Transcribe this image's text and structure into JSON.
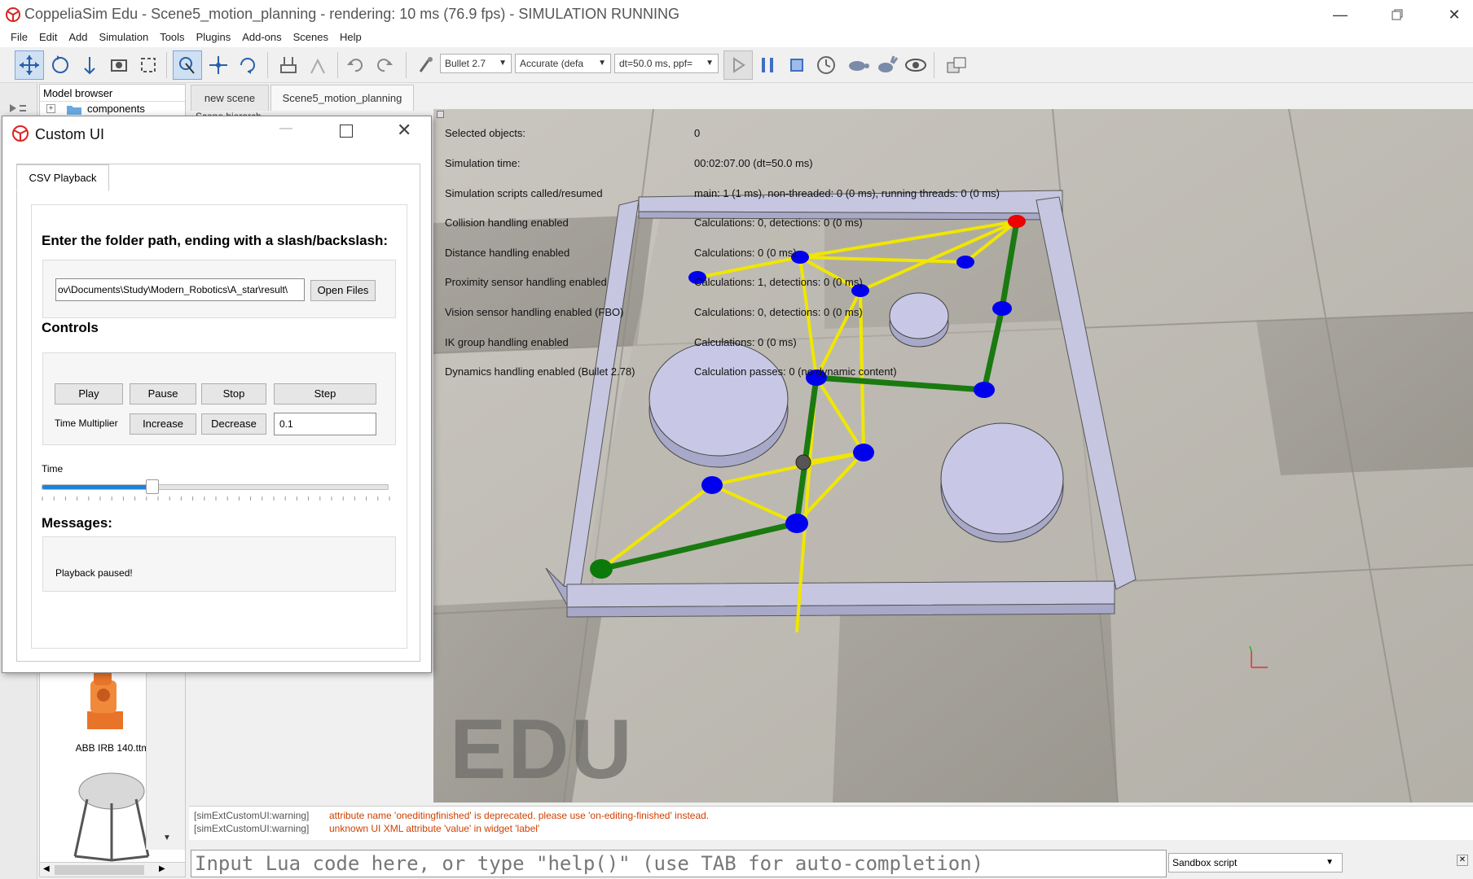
{
  "window": {
    "title": "CoppeliaSim Edu - Scene5_motion_planning - rendering: 10 ms (76.9 fps) - SIMULATION RUNNING"
  },
  "menu": [
    "File",
    "Edit",
    "Add",
    "Simulation",
    "Tools",
    "Plugins",
    "Add-ons",
    "Scenes",
    "Help"
  ],
  "toolbar": {
    "engine": "Bullet 2.7",
    "accuracy": "Accurate (defa",
    "timestep": "dt=50.0 ms, ppf="
  },
  "model_browser": {
    "title": "Model browser",
    "folder": "components",
    "model_label": "ABB IRB 140.ttm"
  },
  "scene_tabs": [
    "new scene",
    "Scene5_motion_planning"
  ],
  "scene_hierarchy_label": "Scene hierarch",
  "info_overlay": {
    "labels": [
      "Selected objects:",
      "Simulation time:",
      "Simulation scripts called/resumed",
      "Collision handling enabled",
      "Distance handling enabled",
      "Proximity sensor handling enabled",
      "Vision sensor handling enabled (FBO)",
      "IK group handling enabled",
      "Dynamics handling enabled (Bullet 2.78)"
    ],
    "values": [
      "0",
      "00:02:07.00 (dt=50.0 ms)",
      "main: 1 (1 ms), non-threaded: 0 (0 ms), running threads: 0 (0 ms)",
      "Calculations: 0, detections: 0 (0 ms)",
      "Calculations: 0 (0 ms)",
      "Calculations: 1, detections: 0 (0 ms)",
      "Calculations: 0, detections: 0 (0 ms)",
      "Calculations: 0 (0 ms)",
      "Calculation passes: 0 (no dynamic content)"
    ]
  },
  "watermark": "EDU",
  "custom_ui": {
    "title": "Custom UI",
    "tab": "CSV Playback",
    "folder_prompt": "Enter the folder path, ending with a slash/backslash:",
    "folder_value": "ov\\Documents\\Study\\Modern_Robotics\\A_star\\result\\",
    "open_files": "Open Files",
    "controls_heading": "Controls",
    "play": "Play",
    "pause": "Pause",
    "stop": "Stop",
    "step": "Step",
    "time_multiplier_label": "Time Multiplier",
    "increase": "Increase",
    "decrease": "Decrease",
    "multiplier_value": "0.1",
    "time_label": "Time",
    "time_slider_fraction": 0.32,
    "messages_heading": "Messages:",
    "message": "Playback paused!"
  },
  "console": {
    "lines": [
      {
        "source": "[simExtCustomUI:warning]",
        "text": "attribute name 'oneditingfinished' is deprecated. please use 'on-editing-finished' instead."
      },
      {
        "source": "[simExtCustomUI:warning]",
        "text": "unknown UI XML attribute 'value' in widget 'label'"
      }
    ],
    "input_placeholder": "Input Lua code here, or type \"help()\" (use TAB for auto-completion)",
    "script_selector": "Sandbox script"
  },
  "colors": {
    "path_edge": "#f0e600",
    "solution_path": "#1a7a10",
    "node": "#0000ee",
    "start_node": "#0b7a0b",
    "goal_node": "#ee0000",
    "obstacle": "#c8c8e6"
  }
}
